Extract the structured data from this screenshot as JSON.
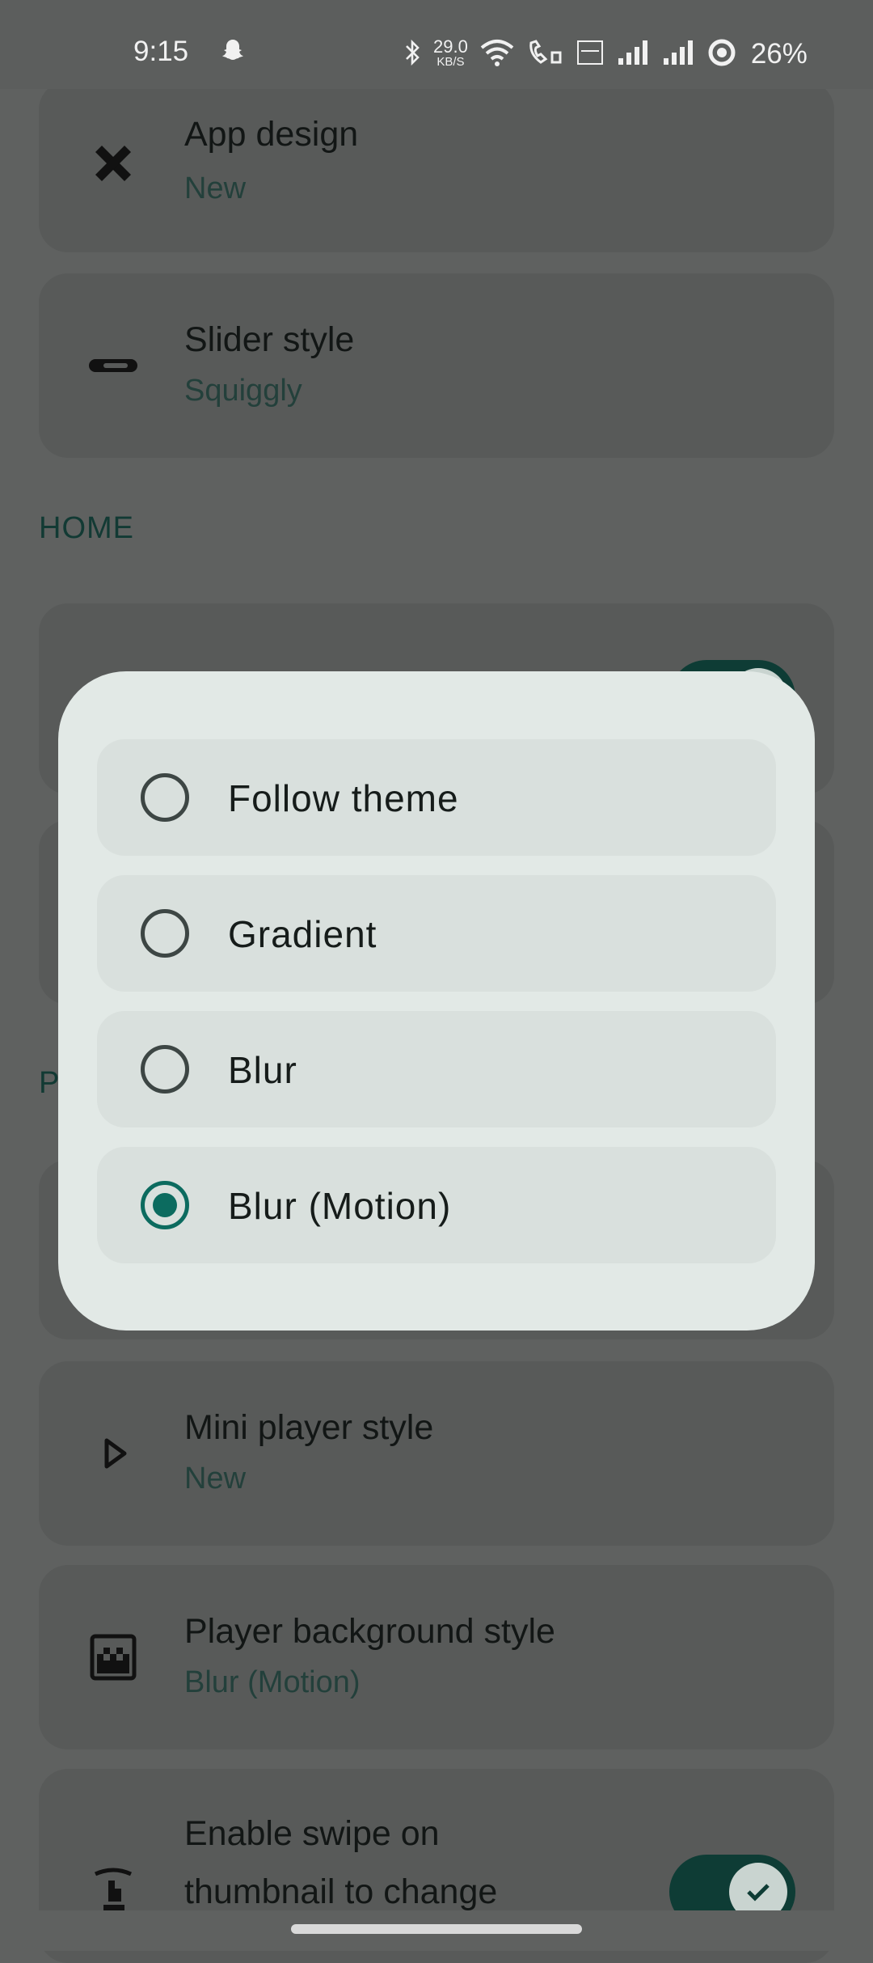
{
  "status_bar": {
    "time": "9:15",
    "net_speed_value": "29.0",
    "net_speed_unit": "KB/S",
    "battery": "26%"
  },
  "background": {
    "app_design": {
      "title": "App design",
      "value": "New"
    },
    "slider_style": {
      "title": "Slider style",
      "value": "Squiggly"
    },
    "home_section": "HOME",
    "player_section_partial": "P",
    "mini_player_style": {
      "title": "Mini player style",
      "value": "New"
    },
    "player_background_style": {
      "title": "Player background style",
      "value": "Blur (Motion)"
    },
    "swipe_thumbnail": {
      "title_line1": "Enable swipe on",
      "title_line2": "thumbnail to change"
    }
  },
  "dialog": {
    "options": [
      {
        "label": "Follow theme",
        "selected": false
      },
      {
        "label": "Gradient",
        "selected": false
      },
      {
        "label": "Blur",
        "selected": false
      },
      {
        "label": "Blur (Motion)",
        "selected": true
      }
    ]
  },
  "colors": {
    "accent": "#0c6b5f",
    "scrim": "#5f6160",
    "dialog": "#e2e9e6"
  }
}
